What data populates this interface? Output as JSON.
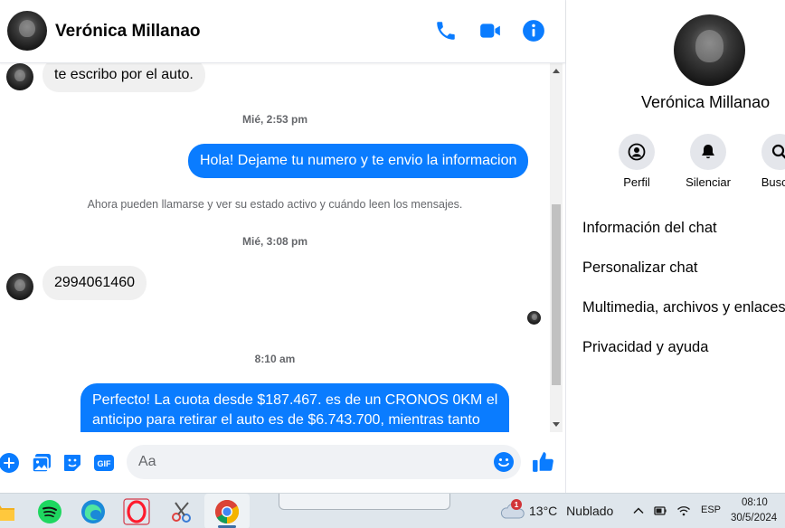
{
  "chat": {
    "contact_name": "Verónica Millanao",
    "messages": [
      {
        "type": "incoming",
        "text": "te escribo por el auto."
      },
      {
        "type": "time",
        "text": "Mié, 2:53 pm"
      },
      {
        "type": "outgoing",
        "text": "Hola! Dejame tu numero y te envio la informacion"
      },
      {
        "type": "notice",
        "text": "Ahora pueden llamarse y ver su estado activo y cuándo leen los mensajes."
      },
      {
        "type": "time",
        "text": "Mié, 3:08 pm"
      },
      {
        "type": "incoming",
        "text": "2994061460"
      },
      {
        "type": "time",
        "text": "8:10 am"
      },
      {
        "type": "outgoing",
        "lines": [
          "Perfecto! La cuota desde $187.467. es de un CRONOS 0KM el",
          "anticipo para retirar el auto es de $6.743.700, mientras tanto"
        ]
      }
    ],
    "composer": {
      "placeholder": "Aa"
    }
  },
  "info_panel": {
    "name": "Verónica Millanao",
    "actions": [
      {
        "label": "Perfil",
        "icon": "profile-icon"
      },
      {
        "label": "Silenciar",
        "icon": "bell-icon"
      },
      {
        "label": "Buscar",
        "icon": "search-icon"
      }
    ],
    "menu": [
      "Información del chat",
      "Personalizar chat",
      "Multimedia, archivos y enlaces",
      "Privacidad y ayuda"
    ]
  },
  "taskbar": {
    "apps": [
      "file-explorer-icon",
      "spotify-icon",
      "edge-icon",
      "opera-icon",
      "snipping-tool-icon",
      "chrome-icon"
    ],
    "weather": {
      "temp": "13°C",
      "condition": "Nublado",
      "badge": "1"
    },
    "language": "ESP",
    "time": "08:10",
    "date": "30/5/2024"
  },
  "colors": {
    "accent": "#0a7cff",
    "incoming_bubble": "#f0f0f0",
    "taskbar": "#dfe6ec"
  }
}
